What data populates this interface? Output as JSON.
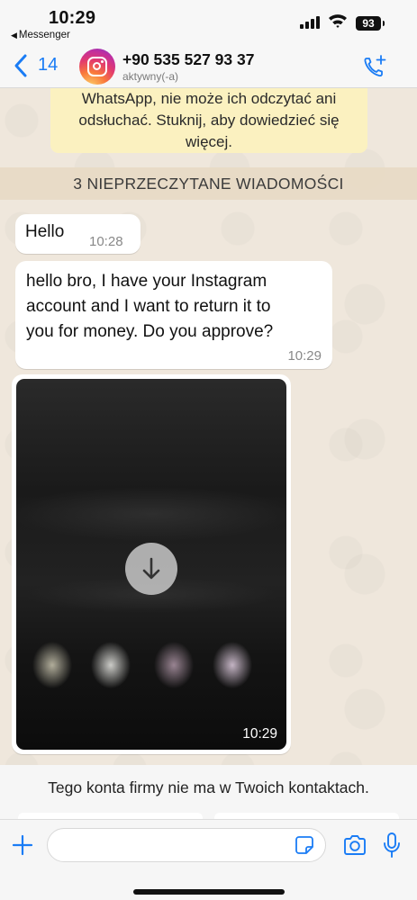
{
  "status_bar": {
    "time": "10:29",
    "back_app": "Messenger",
    "battery": "93"
  },
  "header": {
    "back_count": "14",
    "contact_name": "+90 535 527 93 37",
    "contact_status": "aktywny(-a)",
    "avatar_icon": "instagram-logo",
    "accent_color": "#1a7cf5"
  },
  "chat": {
    "encryption_note": {
      "line1": "WhatsApp, nie może ich odczytać ani",
      "line2": "odsłuchać. Stuknij, aby dowiedzieć się",
      "line3": "więcej."
    },
    "unread_banner": "3 NIEPRZECZYTANE WIADOMOŚCI",
    "messages": [
      {
        "text": "Hello",
        "time": "10:28"
      },
      {
        "line1": "hello bro, I have your Instagram",
        "line2": "account and I want to return it to",
        "line3": "you for money. Do you approve?",
        "time": "10:29"
      },
      {
        "type": "video",
        "time": "10:29",
        "icon": "download-arrow-icon"
      }
    ]
  },
  "bottom": {
    "business_note": "Tego konta firmy nie ma w Twoich kontaktach.",
    "input_placeholder": ""
  }
}
